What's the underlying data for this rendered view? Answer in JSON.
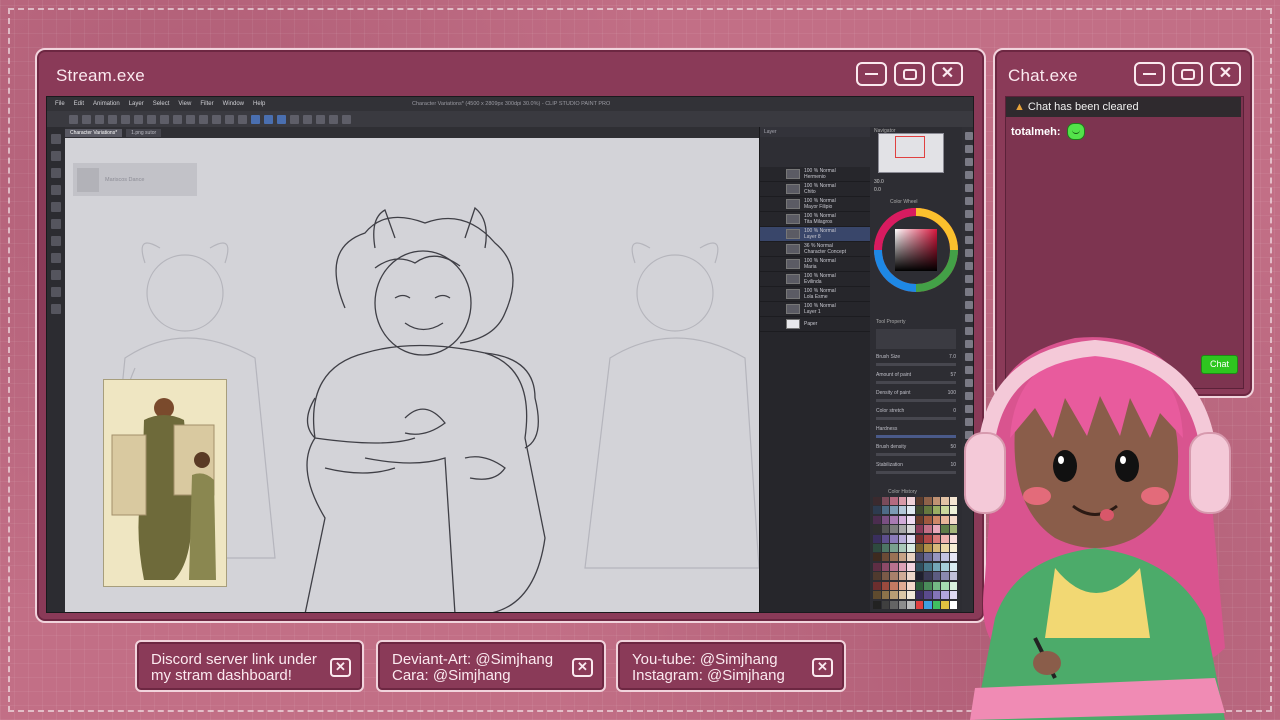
{
  "stream_window": {
    "title": "Stream.exe",
    "controls": {
      "minimize": "",
      "maximize": "",
      "close": "✕"
    },
    "app": {
      "document_title": "Character Variations* (4500 x 2809px 300dpi 30.0%) - CLIP STUDIO PAINT PRO",
      "menu": [
        "File",
        "Edit",
        "Animation",
        "Layer",
        "Select",
        "View",
        "Filter",
        "Window",
        "Help"
      ],
      "tabs": [
        "Character Variations*",
        "1.png sutor"
      ],
      "thumb_card_title": "Mariscos Dance",
      "layers_header": "Layer",
      "layers": [
        {
          "opacity": "100 % Normal",
          "name": "Hermenio"
        },
        {
          "opacity": "100 % Normal",
          "name": "Chito"
        },
        {
          "opacity": "100 % Normal",
          "name": "Mayor Filipio"
        },
        {
          "opacity": "100 % Normal",
          "name": "Tita Milagros"
        },
        {
          "opacity": "100 % Normal",
          "name": "Layer 8"
        },
        {
          "opacity": "36 % Normal",
          "name": "Character Concept"
        },
        {
          "opacity": "100 % Normal",
          "name": "Maria"
        },
        {
          "opacity": "100 % Normal",
          "name": "Evilinda"
        },
        {
          "opacity": "100 % Normal",
          "name": "Lola Esme"
        },
        {
          "opacity": "100 % Normal",
          "name": "Layer 1"
        },
        {
          "opacity": "",
          "name": "Paper"
        }
      ],
      "navigator_label": "Navigator",
      "zoom": "30.0",
      "rotation": "0.0",
      "color_wheel_label": "Color Wheel",
      "tool_property_label": "Tool Property",
      "tool_properties": [
        {
          "label": "Brush Size",
          "value": "7.0"
        },
        {
          "label": "Amount of paint",
          "value": "57"
        },
        {
          "label": "Density of paint",
          "value": "100"
        },
        {
          "label": "Color stretch",
          "value": "0"
        },
        {
          "label": "Hardness",
          "value": ""
        },
        {
          "label": "Brush density",
          "value": "50"
        },
        {
          "label": "Stabilization",
          "value": "10"
        }
      ],
      "color_history_label": "Color History"
    }
  },
  "chat_window": {
    "title": "Chat.exe",
    "controls": {
      "minimize": "",
      "maximize": "",
      "close": "✕"
    },
    "notice": "Chat has been cleared",
    "messages": [
      {
        "user": "totalmeh:",
        "emote": "green-blob-emote"
      }
    ],
    "send_label": "Chat"
  },
  "info_boxes": [
    {
      "line1": "Discord server link under",
      "line2": "my stram dashboard!",
      "close": "✕"
    },
    {
      "line1": "Deviant-Art: @Simjhang",
      "line2": "Cara: @Simjhang",
      "close": "✕"
    },
    {
      "line1": "You-tube: @Simjhang",
      "line2": "Instagram: @Simjhang",
      "close": "✕"
    }
  ],
  "colors": {
    "background": "#c26f86",
    "window": "#8a3a58",
    "window_border": "#f1d3dc",
    "chat_send": "#2ec61f"
  }
}
